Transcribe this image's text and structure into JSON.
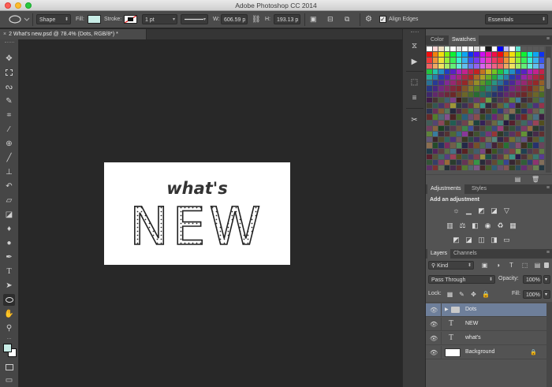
{
  "window": {
    "title": "Adobe Photoshop CC 2014"
  },
  "options_bar": {
    "tool_mode": "Shape",
    "fill_label": "Fill:",
    "fill_color": "#c8ece6",
    "stroke_label": "Stroke:",
    "stroke_width": "1 pt",
    "w_label": "W:",
    "w_value": "606.59 p",
    "link_icon": "link-icon",
    "h_label": "H:",
    "h_value": "193.13 p",
    "align_edges_label": "Align Edges",
    "align_edges_checked": true,
    "workspace": "Essentials"
  },
  "document": {
    "tab_title": "2 What's new.psd @ 78.4% (Dots, RGB/8*) *",
    "art_line1": "what's",
    "art_line2": "NEW"
  },
  "tools": [
    "move-icon",
    "marquee-icon",
    "lasso-icon",
    "quick-select-icon",
    "crop-icon",
    "eyedropper-icon",
    "healing-icon",
    "brush-icon",
    "stamp-icon",
    "history-brush-icon",
    "eraser-icon",
    "gradient-icon",
    "blur-icon",
    "dodge-icon",
    "pen-icon",
    "type-icon",
    "path-select-icon",
    "ellipse-icon",
    "hand-icon",
    "zoom-icon"
  ],
  "foreground_color": "#c8ece6",
  "background_color": "#ffffff",
  "color_panel": {
    "tabs": [
      "Color",
      "Swatches"
    ],
    "active_tab": "Swatches"
  },
  "adjustments_panel": {
    "tabs": [
      "Adjustments",
      "Styles"
    ],
    "title": "Add an adjustment"
  },
  "layers_panel": {
    "tabs": [
      "Layers",
      "Channels"
    ],
    "filter_kind": "Kind",
    "blend_mode": "Pass Through",
    "opacity_label": "Opacity:",
    "opacity_value": "100%",
    "lock_label": "Lock:",
    "fill_label": "Fill:",
    "fill_value": "100%",
    "layers": [
      {
        "name": "Dots",
        "type": "group",
        "selected": true
      },
      {
        "name": "NEW",
        "type": "text",
        "selected": false
      },
      {
        "name": "what's",
        "type": "text",
        "selected": false
      },
      {
        "name": "Background",
        "type": "pixel",
        "selected": false,
        "locked": true
      }
    ]
  }
}
